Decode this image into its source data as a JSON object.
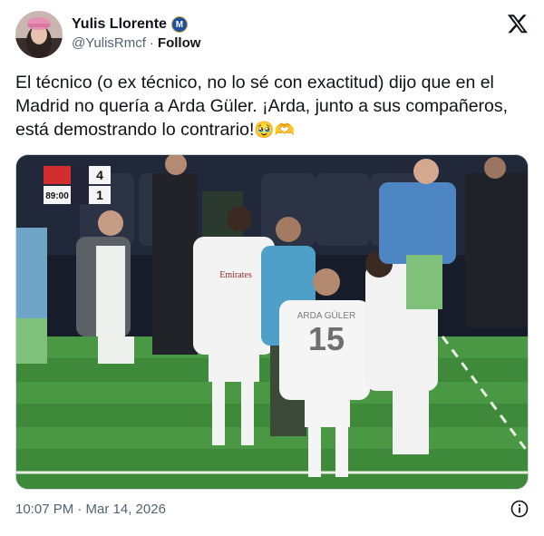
{
  "author": {
    "display_name": "Yulis Llorente",
    "verified_badge": "M",
    "handle": "@YulisRmcf",
    "separator": "·",
    "follow_label": "Follow"
  },
  "tweet": {
    "text": "El técnico (o ex técnico, no lo sé con exactitud) dijo que en el Madrid no quería a Arda Güler. ¡Arda, junto a sus compañeros, está demostrando lo contrario!",
    "emoji_1": "🥹",
    "emoji_2": "🫶"
  },
  "media": {
    "scoreboard": {
      "time": "89:00",
      "home_score": "4",
      "away_score": "1"
    },
    "jersey_name": "ARDA GÜLER",
    "jersey_number": "15",
    "shirt_sponsor": "Emirates"
  },
  "footer": {
    "timestamp": "10:07 PM · Mar 14, 2026"
  },
  "colors": {
    "text": "#0f1419",
    "muted": "#536471",
    "pitch": "#3f8a3a"
  },
  "icons": {
    "logo": "x-logo-icon",
    "info": "info-icon",
    "verified": "verified-badge-icon"
  }
}
